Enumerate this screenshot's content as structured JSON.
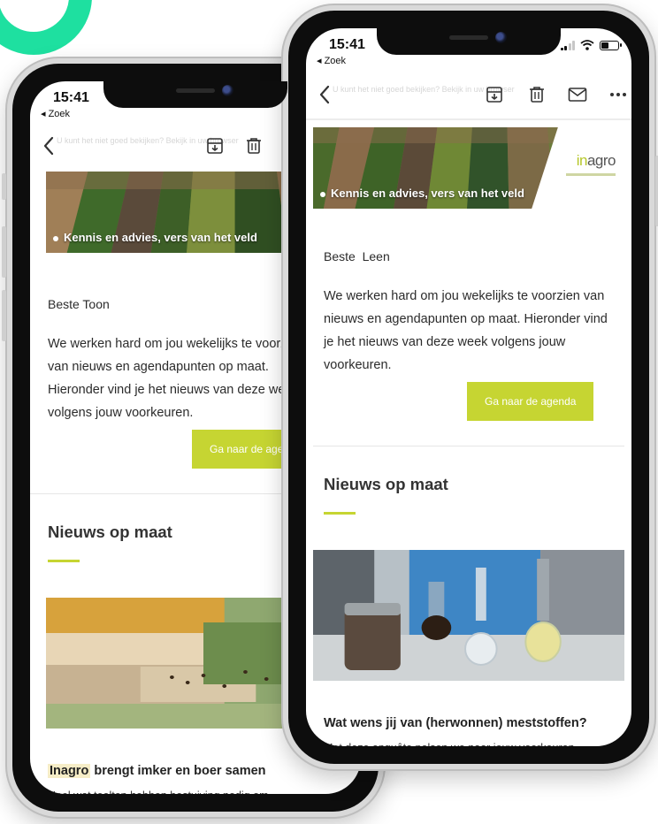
{
  "colors": {
    "accent": "#c6d532",
    "ring": "#1ee0a0",
    "highlight": "#f6edc7"
  },
  "phones": {
    "left": {
      "status": {
        "time": "15:41",
        "back": "◂ Zoek"
      },
      "toolbar": {
        "ghost": "U kunt het niet goed bekijken? Bekijk in uw browser"
      },
      "hero": {
        "caption": "Kennis en advies, vers van het veld"
      },
      "mail": {
        "greeting": "Beste Toon",
        "intro": "We werken hard om jou wekelijks te voorzien van nieuws en agendapunten op maat. Hieronder vind je het nieuws van deze week volgens jouw voorkeuren.",
        "cta": "Ga naar de agenda",
        "section_title": "Nieuws op maat",
        "article": {
          "title_highlight": "Inagro",
          "title_rest": " brengt imker en boer samen",
          "text": "Heel wat teelten hebben bestuiving nodig om"
        }
      }
    },
    "right": {
      "status": {
        "time": "15:41",
        "back": "◂ Zoek"
      },
      "toolbar": {
        "ghost": "U kunt het niet goed bekijken? Bekijk in uw browser"
      },
      "hero": {
        "caption": "Kennis en advies, vers van het veld",
        "logo_prefix": "in",
        "logo_rest": "agro"
      },
      "mail": {
        "greeting": "Beste  Leen",
        "intro": "We werken hard om jou wekelijks te voorzien van nieuws en agendapunten op maat. Hieronder vind je het nieuws van deze week volgens jouw voorkeuren.",
        "cta": "Ga naar de agenda",
        "section_title": "Nieuws op maat",
        "article": {
          "title": "Wat wens jij van (herwonnen) meststoffen?",
          "text": "Met deze enquête polsen we naar jouw voorkeuren bij gebruik van meststoffen in de tuinbouw en"
        }
      }
    }
  },
  "icons": [
    "back-chevron-icon",
    "archive-icon",
    "trash-icon",
    "mail-icon",
    "more-icon",
    "signal-icon",
    "wifi-icon",
    "battery-icon"
  ]
}
